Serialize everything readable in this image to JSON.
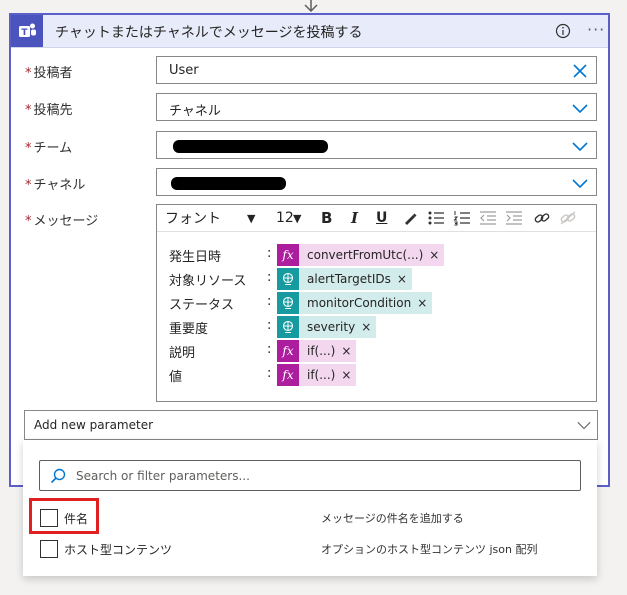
{
  "action": {
    "title": "チャットまたはチャネルでメッセージを投稿する",
    "info_icon": "info-icon",
    "more_label": "···"
  },
  "fields": {
    "poster": {
      "label": "投稿者",
      "value": "User"
    },
    "post_to": {
      "label": "投稿先",
      "value": "チャネル"
    },
    "team": {
      "label": "チーム"
    },
    "channel": {
      "label": "チャネル"
    },
    "message": {
      "label": "メッセージ"
    }
  },
  "editor": {
    "font_name": "フォント",
    "font_size": "12",
    "bold": "B",
    "italic": "I",
    "underline": "U",
    "rows": [
      {
        "label": "発生日時",
        "token": "convertFromUtc(...)",
        "kind": "expression"
      },
      {
        "label": "対象リソース",
        "token": "alertTargetIDs",
        "kind": "dynamic"
      },
      {
        "label": "ステータス",
        "token": "monitorCondition",
        "kind": "dynamic"
      },
      {
        "label": "重要度",
        "token": "severity",
        "kind": "dynamic"
      },
      {
        "label": "説明",
        "token": "if(...)",
        "kind": "expression"
      },
      {
        "label": "値",
        "token": "if(...)",
        "kind": "expression"
      }
    ],
    "colon": ":",
    "fx_label": "fx",
    "remove_label": "×"
  },
  "add_parameter": {
    "label": "Add new parameter"
  },
  "parameter_search": {
    "placeholder": "Search or filter parameters..."
  },
  "parameter_options": [
    {
      "name": "件名",
      "description": "メッセージの件名を追加する",
      "checked": false
    },
    {
      "name": "ホスト型コンテンツ",
      "description": "オプションのホスト型コンテンツ json 配列",
      "checked": false
    }
  ],
  "colors": {
    "accent": "#5b5fc7",
    "teams": "#4b53bc",
    "expression": "#ad1e9e",
    "dynamic": "#179ba0",
    "highlight": "#e02020"
  }
}
